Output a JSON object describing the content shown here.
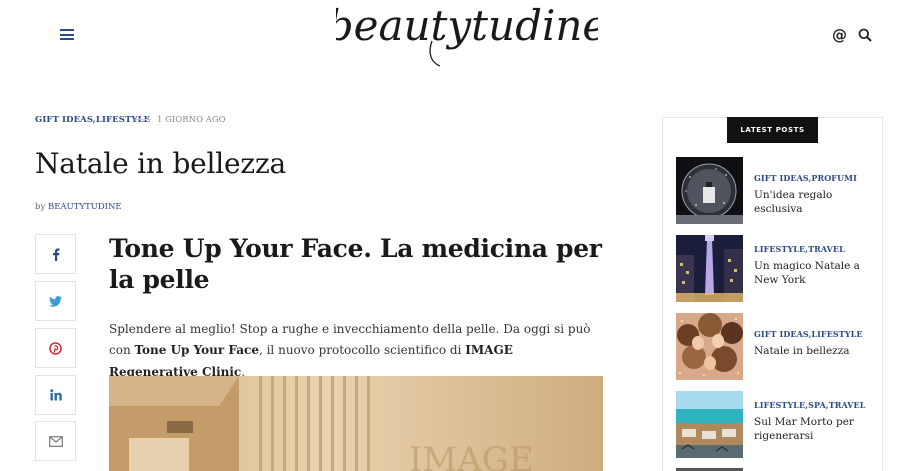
{
  "header": {
    "logo_text": "beautytudine",
    "menu_icon": "hamburger-menu-icon",
    "icons": [
      "at-icon",
      "search-icon"
    ]
  },
  "article": {
    "categories": "GIFT IDEAS,LIFESTYLE",
    "date": "1 GIORNO AGO",
    "title": "Natale in bellezza",
    "byline_prefix": "by",
    "author": "BEAUTYTUDINE",
    "headline": "Tone Up Your Face. La medicina per la pelle",
    "paragraph": {
      "part1": "Splendere al meglio! Stop a rughe e invecchiamento della pelle. Da oggi si può con ",
      "bold1": "Tone Up Your Face",
      "part2": ", il nuovo protocollo scientifico di ",
      "bold2": "IMAGE Regenerative Clinic",
      "part3": "."
    }
  },
  "share": [
    {
      "icon": "facebook-icon",
      "color": "#2c4a8a"
    },
    {
      "icon": "twitter-icon",
      "color": "#3a9bd9"
    },
    {
      "icon": "pinterest-icon",
      "color": "#c8232c"
    },
    {
      "icon": "linkedin-icon",
      "color": "#2c6aa0"
    },
    {
      "icon": "email-icon",
      "color": "#777777"
    }
  ],
  "sidebar": {
    "heading": "LATEST POSTS",
    "posts": [
      {
        "category": "GIFT IDEAS,PROFUMI",
        "title": "Un'idea regalo esclusiva"
      },
      {
        "category": "LIFESTYLE,TRAVEL",
        "title": "Un magico Natale a New York"
      },
      {
        "category": "GIFT IDEAS,LIFESTYLE",
        "title": "Natale in bellezza"
      },
      {
        "category": "LIFESTYLE,SPA,TRAVEL",
        "title": "Sul Mar Morto per rigenerarsi"
      }
    ]
  },
  "colors": {
    "accent": "#2c4a8a",
    "text": "#1a1a1a",
    "muted": "#888888",
    "border": "#e5e5e5"
  }
}
